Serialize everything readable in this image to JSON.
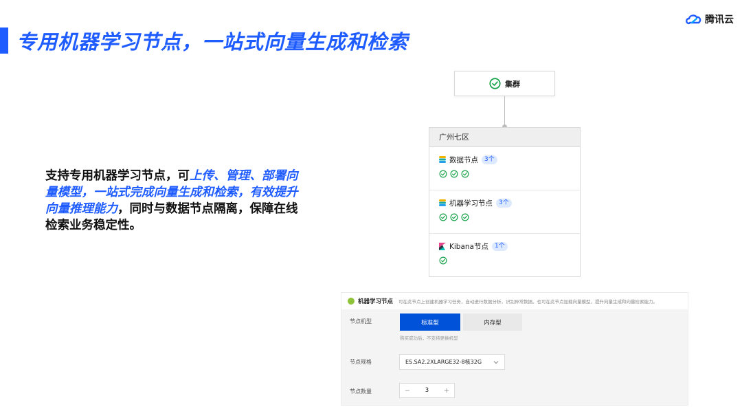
{
  "title": "专用机器学习节点，一站式向量生成和检索",
  "brand": {
    "name": "腾讯云",
    "icon": "tencent-cloud-logo"
  },
  "description": {
    "part1": "支持专用机器学习节点，可",
    "highlight": "上传、管理、部署向量模型，一站式完成向量生成和检索，有效提升向量推理能力",
    "part2": "，同时与数据节点隔离，保障在线检索业务稳定性。"
  },
  "colors": {
    "accent": "#1f5cff",
    "success": "#16a34a",
    "primary_button": "#0052d9"
  },
  "diagram": {
    "cluster": {
      "label": "集群",
      "icon": "check-circle-icon"
    },
    "zone": {
      "name": "广州七区",
      "rows": [
        {
          "label": "数据节点",
          "count": "3个",
          "icon": "elasticsearch-icon",
          "checks": 3
        },
        {
          "label": "机器学习节点",
          "count": "3个",
          "icon": "elasticsearch-icon",
          "checks": 3
        },
        {
          "label": "Kibana节点",
          "count": "1个",
          "icon": "kibana-icon",
          "checks": 1
        }
      ]
    }
  },
  "panel": {
    "title": "机器学习节点",
    "hint": "可在此节点上创建机器学习任务，自动进行数据分析，识别异常数据。也可在此节点加载向量模型，提升向量生成和向量检索能力。",
    "model_type": {
      "label": "节点机型",
      "options": [
        "标准型",
        "内存型"
      ],
      "selected": "标准型",
      "note": "购买成功后，不支持更换机型"
    },
    "spec": {
      "label": "节点规格",
      "value": "ES.SA2.2XLARGE32-8核32G"
    },
    "quantity": {
      "label": "节点数量",
      "value": "3",
      "minus": "−",
      "plus": "+"
    }
  }
}
